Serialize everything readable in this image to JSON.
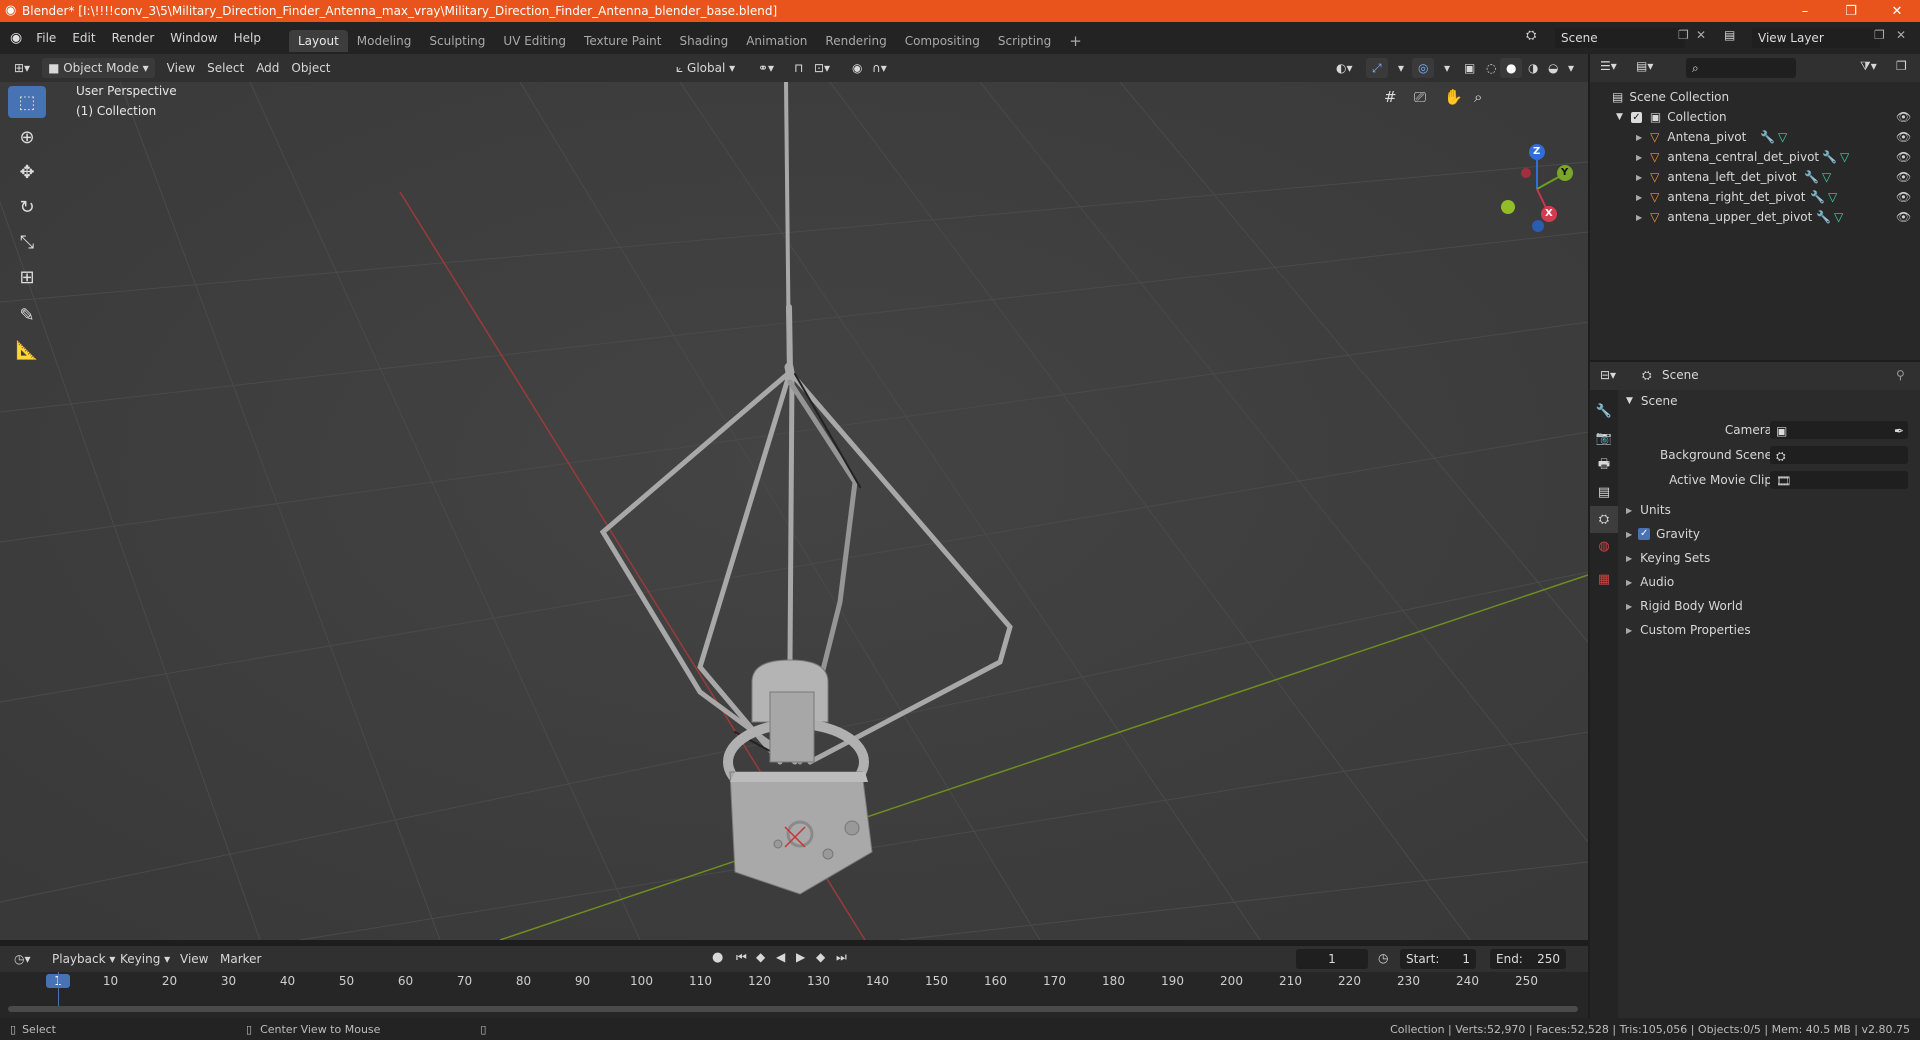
{
  "window": {
    "title": "Blender* [I:\\!!!!conv_3\\5\\Military_Direction_Finder_Antenna_max_vray\\Military_Direction_Finder_Antenna_blender_base.blend]",
    "minimize": "–",
    "restore": "❐",
    "close": "✕"
  },
  "menu": {
    "items": [
      "File",
      "Edit",
      "Render",
      "Window",
      "Help"
    ]
  },
  "workspaces": {
    "tabs": [
      "Layout",
      "Modeling",
      "Sculpting",
      "UV Editing",
      "Texture Paint",
      "Shading",
      "Animation",
      "Rendering",
      "Compositing",
      "Scripting"
    ],
    "active": "Layout",
    "add": "+"
  },
  "scene_selector": {
    "value": "Scene"
  },
  "view_layer": {
    "value": "View Layer"
  },
  "viewport_header": {
    "mode": "Object Mode",
    "view": "View",
    "select": "Select",
    "add": "Add",
    "object": "Object",
    "orientation": "Global"
  },
  "viewport": {
    "perspective": "User Perspective",
    "collection": "(1) Collection",
    "gizmo_x": "X",
    "gizmo_y": "Y",
    "gizmo_z": "Z"
  },
  "outliner": {
    "search_placeholder": "",
    "root": "Scene Collection",
    "collection": "Collection",
    "objects": [
      "Antena_pivot",
      "antena_central_det_pivot",
      "antena_left_det_pivot",
      "antena_right_det_pivot",
      "antena_upper_det_pivot"
    ]
  },
  "properties": {
    "header": "Scene",
    "panel": "Scene",
    "camera_label": "Camera",
    "background_scene_label": "Background Scene",
    "active_movie_clip_label": "Active Movie Clip",
    "sections": [
      "Units",
      "Gravity",
      "Keying Sets",
      "Audio",
      "Rigid Body World",
      "Custom Properties"
    ],
    "gravity_checked": true
  },
  "timeline": {
    "playback": "Playback",
    "keying": "Keying",
    "view": "View",
    "marker": "Marker",
    "current_frame": "1",
    "start_label": "Start:",
    "start": "1",
    "end_label": "End:",
    "end": "250",
    "ticks": [
      "1",
      "10",
      "20",
      "30",
      "40",
      "50",
      "60",
      "70",
      "80",
      "90",
      "100",
      "110",
      "120",
      "130",
      "140",
      "150",
      "160",
      "170",
      "180",
      "190",
      "200",
      "210",
      "220",
      "230",
      "240",
      "250"
    ]
  },
  "status": {
    "select": "Select",
    "center_view": "Center View to Mouse",
    "stats": "Collection | Verts:52,970 | Faces:52,528 | Tris:105,056 | Objects:0/5 | Mem: 40.5 MB | v2.80.75"
  },
  "colors": {
    "accent": "#4772b3",
    "titlebar": "#e8541c",
    "x_axis": "#9b3a3a",
    "y_axis": "#6e8e1e",
    "object_icon": "#e99a3c",
    "modifier_icon": "#5aa0e0",
    "mesh_icon": "#3fd6a0"
  }
}
